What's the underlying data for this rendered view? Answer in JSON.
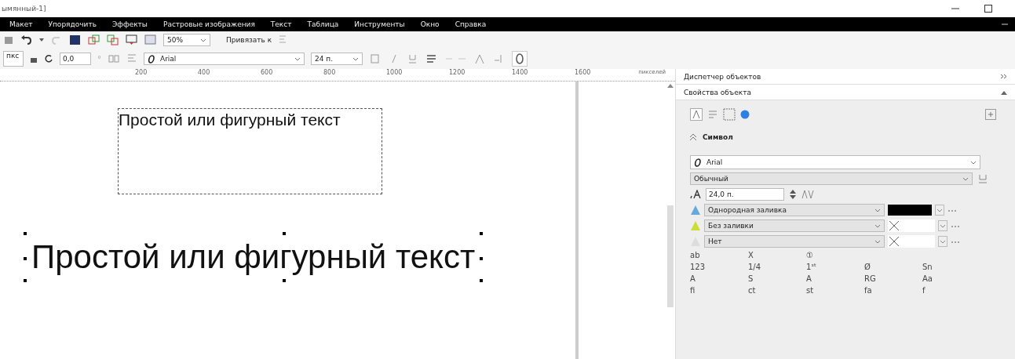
{
  "window": {
    "title": "ымянный-1]"
  },
  "menu": [
    {
      "label": "Макет"
    },
    {
      "label": "Упорядочить"
    },
    {
      "label": "Эффекты"
    },
    {
      "label": "Растровые изображения"
    },
    {
      "label": "Текст"
    },
    {
      "label": "Таблица"
    },
    {
      "label": "Инструменты"
    },
    {
      "label": "Окно"
    },
    {
      "label": "Справка"
    }
  ],
  "toolbar": {
    "zoom": "50%",
    "snap": "Привязать к"
  },
  "property_bar": {
    "units": "пкс",
    "rotation": "0,0",
    "degree": "°",
    "font": "Arial",
    "size": "24 п."
  },
  "ruler": {
    "ticks": [
      "200",
      "400",
      "600",
      "800",
      "1000",
      "1200",
      "1400",
      "1600"
    ],
    "units": "пикселей"
  },
  "canvas": {
    "paragraph_text": "Простой или фигурный текст",
    "artistic_text": "Простой или фигурный текст"
  },
  "docker": {
    "title": "Диспетчер объектов",
    "section": "Свойства объекта",
    "group": "Символ",
    "font": "Arial",
    "style": "Обычный",
    "size": "24,0 п.",
    "fills": [
      {
        "kind": "color",
        "label": "Однородная заливка",
        "color": "#000000"
      },
      {
        "kind": "none",
        "label": "Без заливки"
      },
      {
        "kind": "none",
        "label": "Нет"
      }
    ],
    "glyphs": [
      [
        "ab",
        "X",
        "①"
      ],
      [
        "123",
        "1/4",
        "1ˢᵗ",
        "Ø",
        "Sn"
      ],
      [
        "A",
        "S",
        "A",
        "RG",
        "Aa"
      ],
      [
        "fi",
        "ct",
        "st",
        "fa",
        "f"
      ]
    ]
  }
}
